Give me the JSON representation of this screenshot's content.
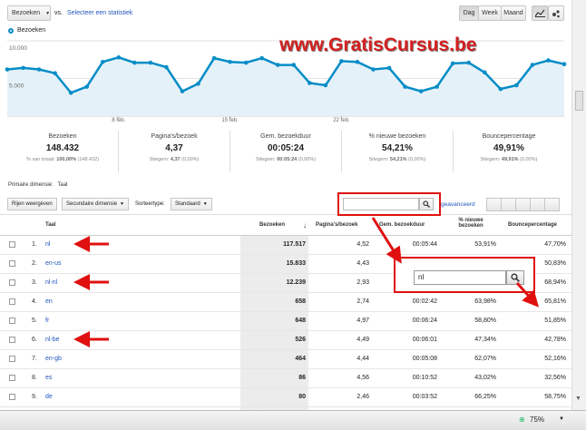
{
  "toolbar": {
    "metric_select": "Bezoeken",
    "vs_label": "vs.",
    "select_metric_link": "Selecteer een statistiek",
    "period_buttons": [
      "Dag",
      "Week",
      "Maand"
    ],
    "active_period": "Dag"
  },
  "watermark": "www.GratisCursus.be",
  "chart_data": {
    "type": "area",
    "legend": "Bezoeken",
    "y_ticks": [
      "10.000",
      "5.000"
    ],
    "x_ticks": [
      "8 feb.",
      "15 feb.",
      "22 feb."
    ],
    "ylim": [
      0,
      10000
    ],
    "values": [
      6200,
      6400,
      6200,
      5700,
      3100,
      3900,
      7200,
      7800,
      7100,
      7100,
      6500,
      3300,
      4300,
      7700,
      7200,
      7100,
      7700,
      6800,
      6800,
      4400,
      4100,
      7300,
      7200,
      6200,
      6400,
      3900,
      3300,
      3900,
      7000,
      7100,
      5800,
      3600,
      4100,
      6800,
      7400,
      6900
    ],
    "accent": "#058dc7",
    "fill": "#e5f1f8"
  },
  "metrics": [
    {
      "label": "Bezoeken",
      "value": "148.432",
      "sub": "% van totaal:",
      "sub_bold": "100,00%",
      "sub_tail": "(148.432)"
    },
    {
      "label": "Pagina's/bezoek",
      "value": "4,37",
      "sub": "Sitegem:",
      "sub_bold": "4,37",
      "sub_tail": "(0,00%)"
    },
    {
      "label": "Gem. bezoekduur",
      "value": "00:05:24",
      "sub": "Sitegem:",
      "sub_bold": "00:05:24",
      "sub_tail": "(0,00%)"
    },
    {
      "label": "% nieuwe bezoeken",
      "value": "54,21%",
      "sub": "Sitegem:",
      "sub_bold": "54,21%",
      "sub_tail": "(0,00%)"
    },
    {
      "label": "Bouncepercentage",
      "value": "49,91%",
      "sub": "Sitegem:",
      "sub_bold": "49,91%",
      "sub_tail": "(0,00%)"
    }
  ],
  "primary_dimension": {
    "label": "Primaire dimensie:",
    "value": "Taal"
  },
  "table_toolbar": {
    "rows_button": "Rijen weergeven",
    "secondary_dimension": "Secundaire dimensie",
    "sort_label": "Sorteertype:",
    "sort_value": "Standaard",
    "advanced_link": "geavanceerd",
    "search_value": ""
  },
  "table": {
    "headers": [
      "Taal",
      "Bezoeken",
      "Pagina's/bezoek",
      "Gem. bezoekduur",
      "% nieuwe bezoeken",
      "Bouncepercentage"
    ],
    "rows": [
      {
        "idx": "1.",
        "name": "nl",
        "visits": "117.517",
        "pages": "4,52",
        "duration": "00:05:44",
        "newv": "53,91%",
        "bounce": "47,70%"
      },
      {
        "idx": "2.",
        "name": "en-us",
        "visits": "15.833",
        "pages": "4,43",
        "duration": "",
        "newv": "",
        "bounce": "50,83%"
      },
      {
        "idx": "3.",
        "name": "nl-nl",
        "visits": "12.239",
        "pages": "2,93",
        "duration": "",
        "newv": "",
        "bounce": "68,94%"
      },
      {
        "idx": "4.",
        "name": "en",
        "visits": "658",
        "pages": "2,74",
        "duration": "00:02:42",
        "newv": "63,98%",
        "bounce": "65,81%"
      },
      {
        "idx": "5.",
        "name": "fr",
        "visits": "648",
        "pages": "4,97",
        "duration": "00:06:24",
        "newv": "58,80%",
        "bounce": "51,85%"
      },
      {
        "idx": "6.",
        "name": "nl-be",
        "visits": "526",
        "pages": "4,49",
        "duration": "00:06:01",
        "newv": "47,34%",
        "bounce": "42,78%"
      },
      {
        "idx": "7.",
        "name": "en-gb",
        "visits": "464",
        "pages": "4,44",
        "duration": "00:05:08",
        "newv": "62,07%",
        "bounce": "52,16%"
      },
      {
        "idx": "8.",
        "name": "es",
        "visits": "86",
        "pages": "4,56",
        "duration": "00:10:52",
        "newv": "43,02%",
        "bounce": "32,56%"
      },
      {
        "idx": "9.",
        "name": "de",
        "visits": "80",
        "pages": "2,46",
        "duration": "00:03:52",
        "newv": "66,25%",
        "bounce": "58,75%"
      }
    ]
  },
  "zoom_popup": {
    "search_value": "nl"
  },
  "statusbar": {
    "zoom": "75%"
  },
  "colors": {
    "annotation_red": "#e01010",
    "link_blue": "#2255bb",
    "chart_blue": "#058dc7"
  }
}
